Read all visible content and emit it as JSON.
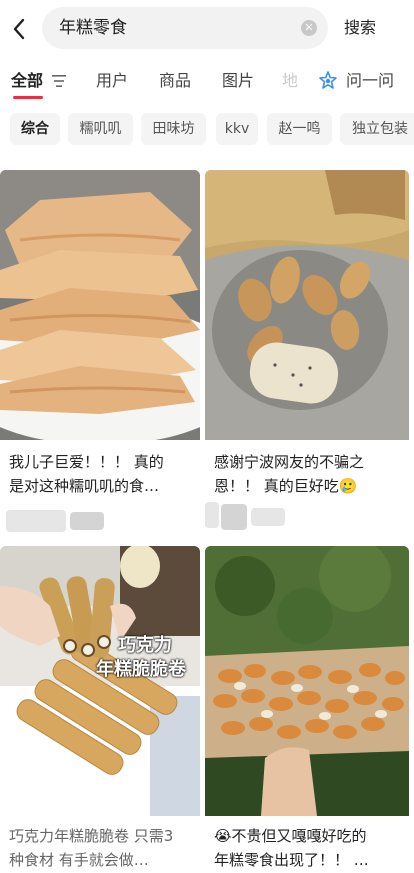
{
  "search": {
    "query": "年糕零食",
    "submit_label": "搜索"
  },
  "tabs": {
    "items": [
      "全部",
      "用户",
      "商品",
      "图片"
    ],
    "active_index": 0,
    "ask_label": "问一问",
    "accent_color": "#ff2442"
  },
  "chips": [
    "综合",
    "糯叽叽",
    "田味坊",
    "kkv",
    "赵一鸣",
    "独立包装"
  ],
  "feed": [
    {
      "title_line1": "我儿子巨爱！！！ 真的",
      "title_line2": "是对这种糯叽叽的食…",
      "image": "stack of thin baked nian gao crisps on a white plate"
    },
    {
      "title_line1": "感谢宁波网友的不骗之",
      "title_line2": "恩！！ 真的巨好吃🥲",
      "image": "open bag of thin crispy rice cake snacks"
    },
    {
      "title_line1": "巧克力年糕脆脆卷 只需3",
      "title_line2": "种食材 有手就会做…",
      "overlay_text_line1": "巧克力",
      "overlay_text_line2": "年糕脆脆卷",
      "image": "chocolate rice cake crispy rolls on a tray"
    },
    {
      "title_line1": "😭不贵但又嘎嘎好吃的",
      "title_line2": "年糕零食出现了！！ …",
      "image": "tray of seasoned crispy nian gao pieces held outdoors"
    }
  ],
  "icons": {
    "back": "back-arrow-icon",
    "clear": "clear-icon",
    "filter": "filter-icon",
    "ask": "ask-icon"
  }
}
